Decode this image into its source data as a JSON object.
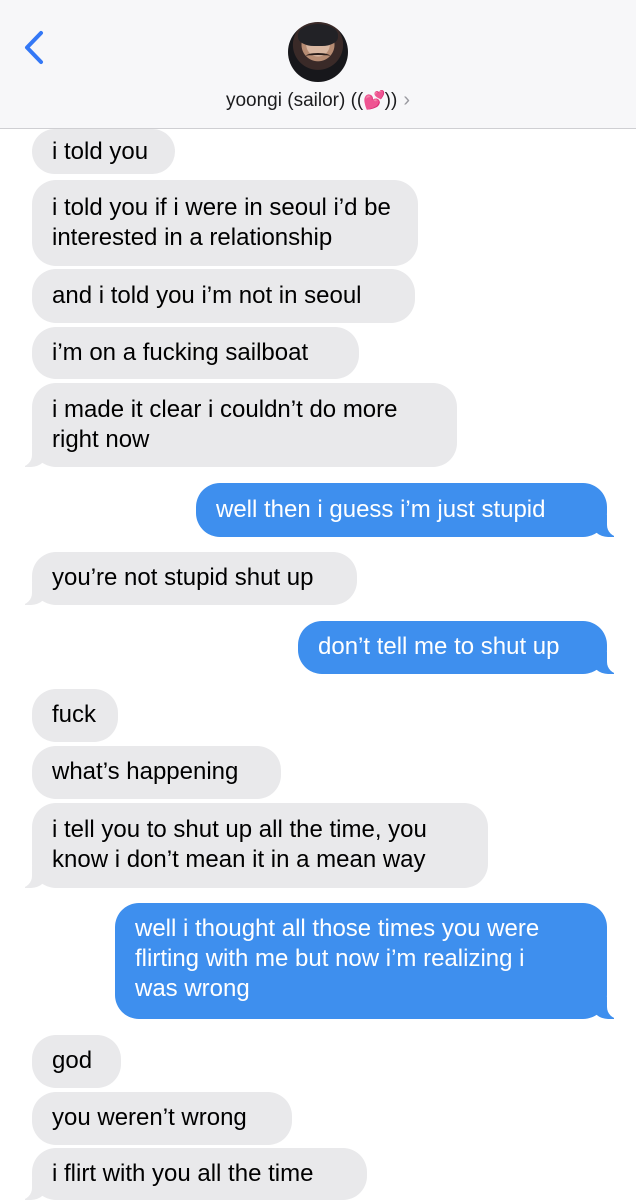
{
  "header": {
    "contact_name": "yoongi (sailor) ((",
    "contact_emoji": "💕",
    "contact_suffix": "))",
    "chevron": "›",
    "back_icon": "chevron-left-icon",
    "avatar": "contact-avatar-photo"
  },
  "colors": {
    "incoming_bubble": "#e9e9eb",
    "outgoing_bubble": "#3e8fee",
    "accent": "#3478f6"
  },
  "messages": [
    {
      "from": "them",
      "text": "i told you"
    },
    {
      "from": "them",
      "text": "i told you if i were in seoul i’d be\ninterested in a relationship"
    },
    {
      "from": "them",
      "text": "and i told you i’m not in seoul"
    },
    {
      "from": "them",
      "text": "i’m on a fucking sailboat"
    },
    {
      "from": "them",
      "text": "i made it clear i couldn’t do more\nright now"
    },
    {
      "from": "me",
      "text": "well then i guess i’m just stupid"
    },
    {
      "from": "them",
      "text": "you’re not stupid shut up"
    },
    {
      "from": "me",
      "text": "don’t tell me to shut up"
    },
    {
      "from": "them",
      "text": "fuck"
    },
    {
      "from": "them",
      "text": "what’s happening"
    },
    {
      "from": "them",
      "text": "i tell you to shut up all the time, you\nknow i don’t mean it in a mean way"
    },
    {
      "from": "me",
      "text": "well i thought all those times you were\nflirting with me but now i’m realizing i\nwas wrong"
    },
    {
      "from": "them",
      "text": "god"
    },
    {
      "from": "them",
      "text": "you weren’t wrong"
    },
    {
      "from": "them",
      "text": "i flirt with you all the time"
    }
  ]
}
